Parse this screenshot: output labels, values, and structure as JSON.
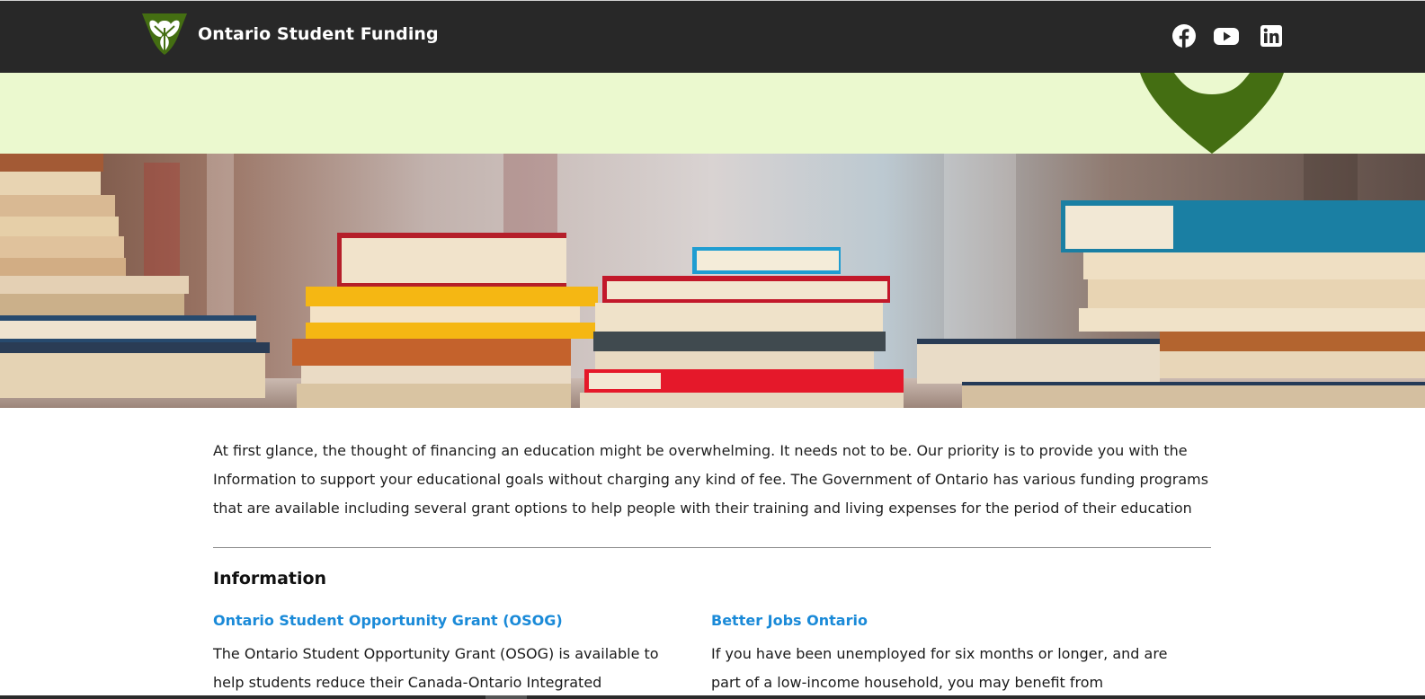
{
  "header": {
    "site_title": "Ontario Student Funding",
    "logo_icon": "ontario-trillium-logo",
    "social_links": [
      {
        "name": "facebook-icon"
      },
      {
        "name": "youtube-icon"
      },
      {
        "name": "linkedin-icon"
      }
    ]
  },
  "colors": {
    "topbar": "#282828",
    "band": "#ebf9cf",
    "brand_green": "#446e12",
    "link_blue": "#1a8ad8"
  },
  "hero": {
    "image": "stacks-of-books-photo"
  },
  "main": {
    "intro": "At first glance, the thought of financing an education might be overwhelming. It needs not to be. Our priority is to provide you with the Information to support your educational goals without charging any kind of fee. The Government of Ontario has various funding programs that are available including several grant options to help people with their training and living expenses for the period of their education",
    "section_title": "Information",
    "cards": [
      {
        "title": "Ontario Student Opportunity Grant (OSOG)",
        "text": "The Ontario Student Opportunity Grant (OSOG) is available to help students reduce their Canada-Ontario Integrated"
      },
      {
        "title": "Better Jobs Ontario",
        "text": "If you have been unemployed for six months or longer, and are part of a low-income household, you may benefit from"
      }
    ]
  }
}
